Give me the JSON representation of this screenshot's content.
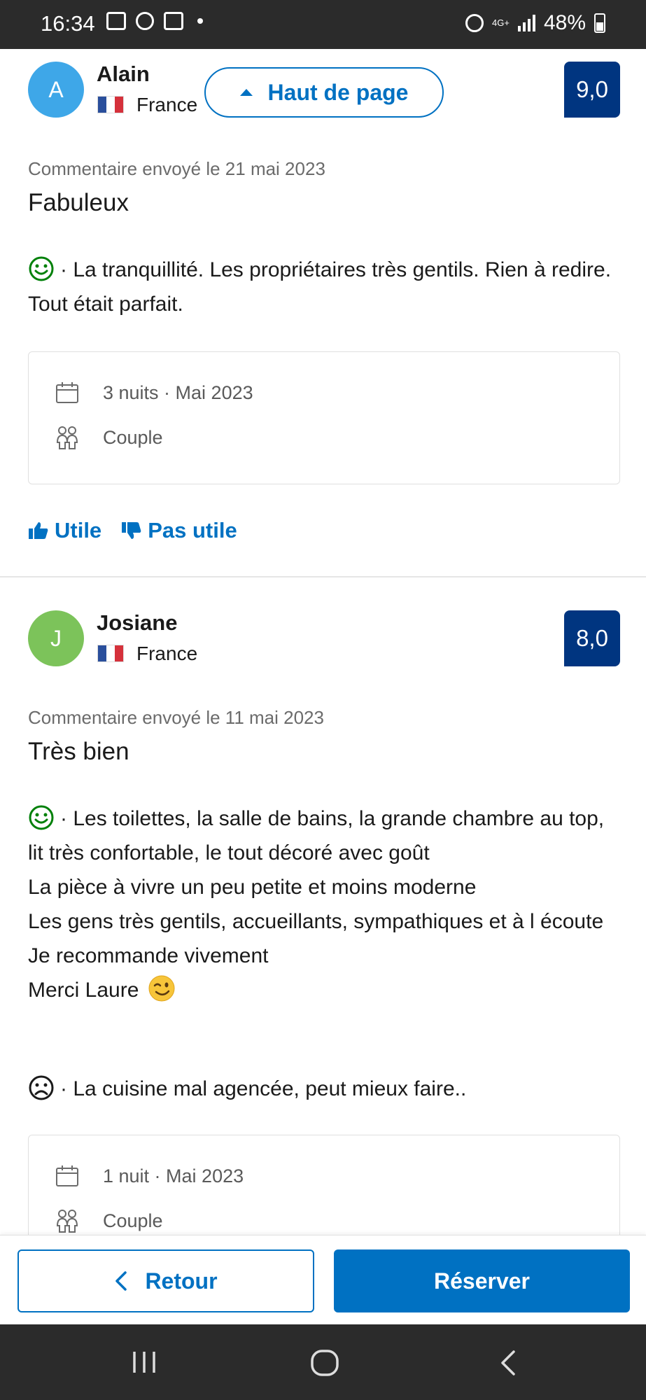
{
  "status_bar": {
    "time": "16:34",
    "network": "4G+",
    "battery": "48%"
  },
  "floating": {
    "back_to_top": "Haut de page"
  },
  "reviews": [
    {
      "initial": "A",
      "avatar_color": "#3ea7e8",
      "name": "Alain",
      "country": "France",
      "score": "9,0",
      "date": "Commentaire envoyé le 21 mai 2023",
      "title": "Fabuleux",
      "positive": "· La tranquillité. Les propriétaires très gentils. Rien à redire. Tout était parfait.",
      "stay": "3 nuits · Mai 2023",
      "traveler": "Couple",
      "helpful": "Utile",
      "not_helpful": "Pas utile"
    },
    {
      "initial": "J",
      "avatar_color": "#7cc35a",
      "name": "Josiane",
      "country": "France",
      "score": "8,0",
      "date": "Commentaire envoyé le 11 mai 2023",
      "title": "Très bien",
      "positive_lines": [
        "· Les toilettes, la salle de bains, la grande chambre au top, lit très confortable, le tout décoré avec goût",
        "La pièce à vivre un peu petite et moins moderne",
        "Les gens très gentils, accueillants, sympathiques et à l écoute",
        "Je recommande vivement",
        "Merci Laure"
      ],
      "negative": "· La cuisine mal agencée, peut mieux faire..",
      "stay": "1 nuit · Mai 2023",
      "traveler": "Couple"
    }
  ],
  "actions": {
    "back": "Retour",
    "book": "Réserver"
  },
  "colors": {
    "brand": "#0071c2",
    "score_bg": "#003580",
    "positive": "#008009",
    "negative": "#1a1a1a"
  }
}
